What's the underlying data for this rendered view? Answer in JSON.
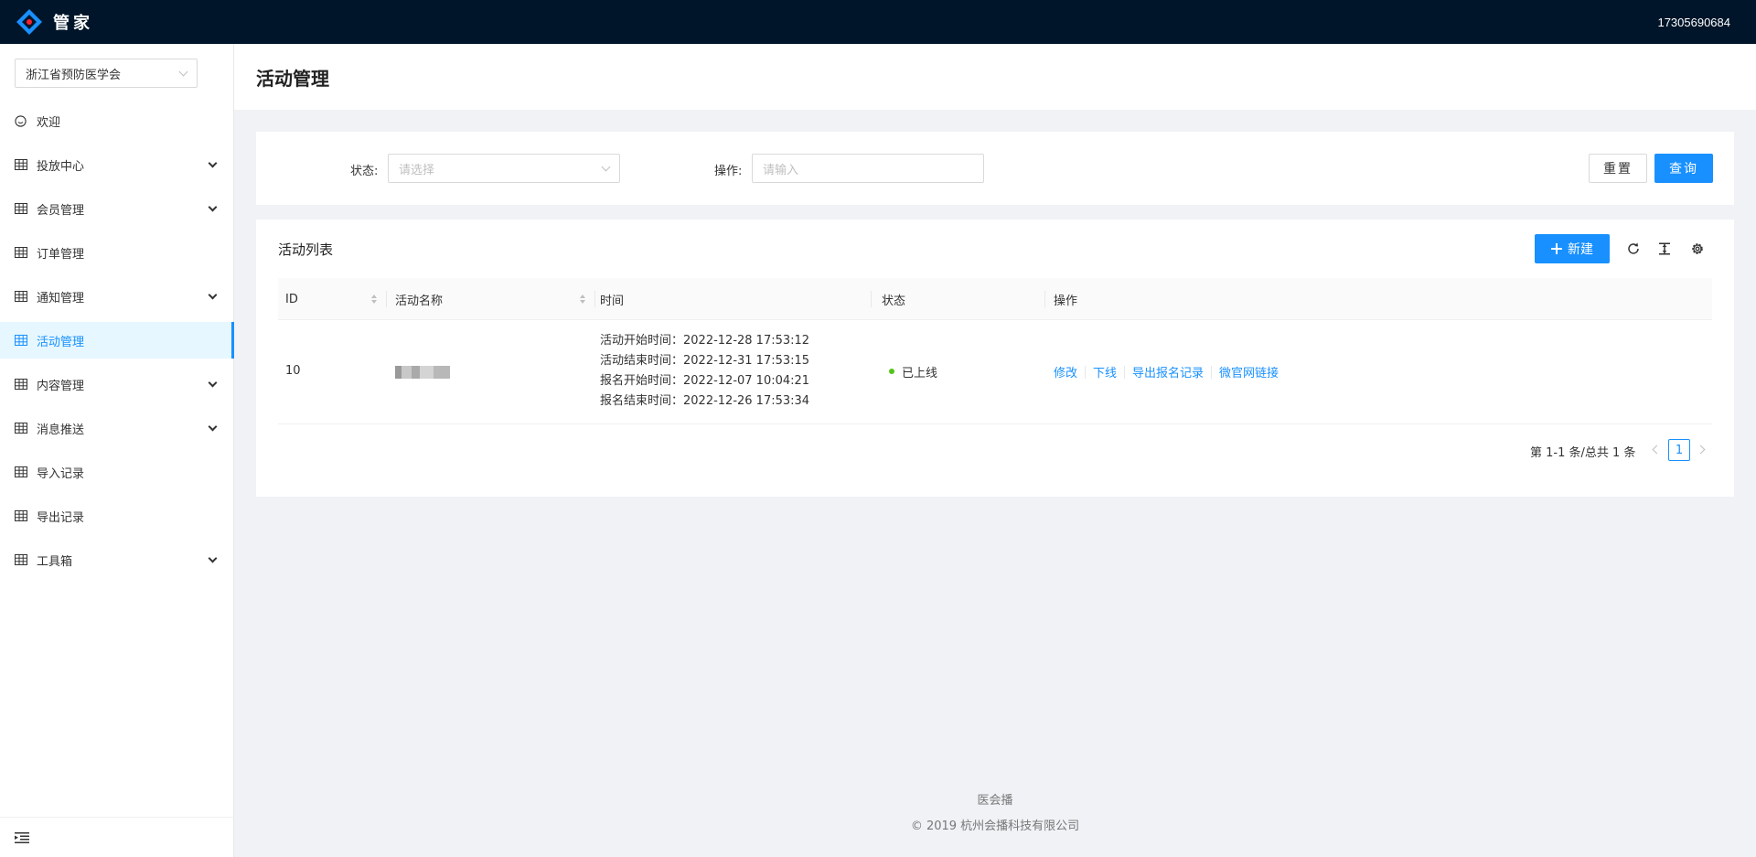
{
  "header": {
    "brand": "管家",
    "account": "17305690684"
  },
  "sidebar": {
    "org_select": "浙江省预防医学会",
    "items": [
      {
        "label": "欢迎",
        "icon": "smile-icon",
        "expandable": false,
        "active": false
      },
      {
        "label": "投放中心",
        "icon": "table-icon",
        "expandable": true,
        "active": false
      },
      {
        "label": "会员管理",
        "icon": "table-icon",
        "expandable": true,
        "active": false
      },
      {
        "label": "订单管理",
        "icon": "table-icon",
        "expandable": false,
        "active": false
      },
      {
        "label": "通知管理",
        "icon": "table-icon",
        "expandable": true,
        "active": false
      },
      {
        "label": "活动管理",
        "icon": "table-icon",
        "expandable": false,
        "active": true
      },
      {
        "label": "内容管理",
        "icon": "table-icon",
        "expandable": true,
        "active": false
      },
      {
        "label": "消息推送",
        "icon": "table-icon",
        "expandable": true,
        "active": false
      },
      {
        "label": "导入记录",
        "icon": "table-icon",
        "expandable": false,
        "active": false
      },
      {
        "label": "导出记录",
        "icon": "table-icon",
        "expandable": false,
        "active": false
      },
      {
        "label": "工具箱",
        "icon": "table-icon",
        "expandable": true,
        "active": false
      }
    ]
  },
  "page": {
    "title": "活动管理"
  },
  "search": {
    "status_label": "状态:",
    "status_placeholder": "请选择",
    "operation_label": "操作:",
    "operation_placeholder": "请输入",
    "reset_label": "重置",
    "query_label": "查询"
  },
  "table": {
    "title": "活动列表",
    "new_label": "新建",
    "columns": [
      "ID",
      "活动名称",
      "时间",
      "状态",
      "操作"
    ],
    "rows": [
      {
        "id": "10",
        "name": "",
        "times": [
          "活动开始时间：2022-12-28 17:53:12",
          "活动结束时间：2022-12-31 17:53:15",
          "报名开始时间：2022-12-07 10:04:21",
          "报名结束时间：2022-12-26 17:53:34"
        ],
        "status": "已上线",
        "status_color": "#52c41a",
        "actions": [
          "修改",
          "下线",
          "导出报名记录",
          "微官网链接"
        ]
      }
    ],
    "pagination": {
      "summary": "第 1-1 条/总共 1 条",
      "current_page": "1"
    }
  },
  "footer": {
    "brand": "医会播",
    "copyright": "2019 杭州会播科技有限公司"
  },
  "colors": {
    "primary": "#1890ff",
    "header_bg": "#001529",
    "success": "#52c41a"
  }
}
